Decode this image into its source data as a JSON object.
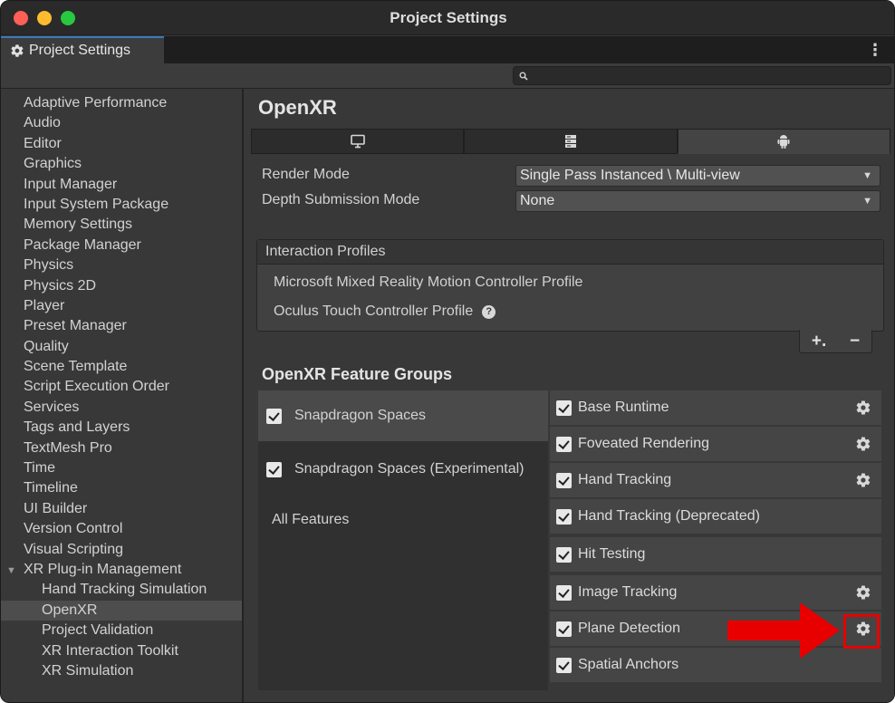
{
  "window": {
    "title": "Project Settings"
  },
  "tab": {
    "label": "Project Settings",
    "icon": "gear-icon",
    "menu_icon": "⋮"
  },
  "search": {
    "placeholder": "",
    "value": ""
  },
  "sidebar": {
    "items": [
      "Adaptive Performance",
      "Audio",
      "Editor",
      "Graphics",
      "Input Manager",
      "Input System Package",
      "Memory Settings",
      "Package Manager",
      "Physics",
      "Physics 2D",
      "Player",
      "Preset Manager",
      "Quality",
      "Scene Template",
      "Script Execution Order",
      "Services",
      "Tags and Layers",
      "TextMesh Pro",
      "Time",
      "Timeline",
      "UI Builder",
      "Version Control",
      "Visual Scripting"
    ],
    "xr_parent": "XR Plug-in Management",
    "xr_children": [
      "Hand Tracking Simulation",
      "OpenXR",
      "Project Validation",
      "XR Interaction Toolkit",
      "XR Simulation"
    ],
    "selected": "OpenXR"
  },
  "main": {
    "title": "OpenXR",
    "platform_tabs": [
      "desktop-icon",
      "server-icon",
      "android-icon"
    ],
    "active_platform": "android",
    "render_mode": {
      "label": "Render Mode",
      "value": "Single Pass Instanced \\ Multi-view"
    },
    "depth_mode": {
      "label": "Depth Submission Mode",
      "value": "None"
    },
    "interaction_profiles": {
      "header": "Interaction Profiles",
      "items": [
        "Microsoft Mixed Reality Motion Controller Profile",
        "Oculus Touch Controller Profile"
      ],
      "add": "+.",
      "remove": "−"
    },
    "feature_groups_title": "OpenXR Feature Groups",
    "groups": [
      {
        "label": "Snapdragon Spaces",
        "checked": true
      },
      {
        "label": "Snapdragon Spaces (Experimental)",
        "checked": true
      },
      {
        "label": "All Features",
        "checked": false
      }
    ],
    "features": [
      {
        "label": "Base Runtime",
        "checked": true,
        "gear": true
      },
      {
        "label": "Foveated Rendering",
        "checked": true,
        "gear": true
      },
      {
        "label": "Hand Tracking",
        "checked": true,
        "gear": true
      },
      {
        "label": "Hand Tracking (Deprecated)",
        "checked": true,
        "gear": false
      },
      {
        "label": "Hit Testing",
        "checked": true,
        "gear": false
      },
      {
        "label": "Image Tracking",
        "checked": true,
        "gear": true
      },
      {
        "label": "Plane Detection",
        "checked": true,
        "gear": true
      },
      {
        "label": "Spatial Anchors",
        "checked": true,
        "gear": false
      }
    ]
  },
  "annotation": {
    "color": "#e80000"
  },
  "colors": {
    "accent": "#3a79bb",
    "panel": "#383838",
    "selected": "#4d4d4d"
  }
}
